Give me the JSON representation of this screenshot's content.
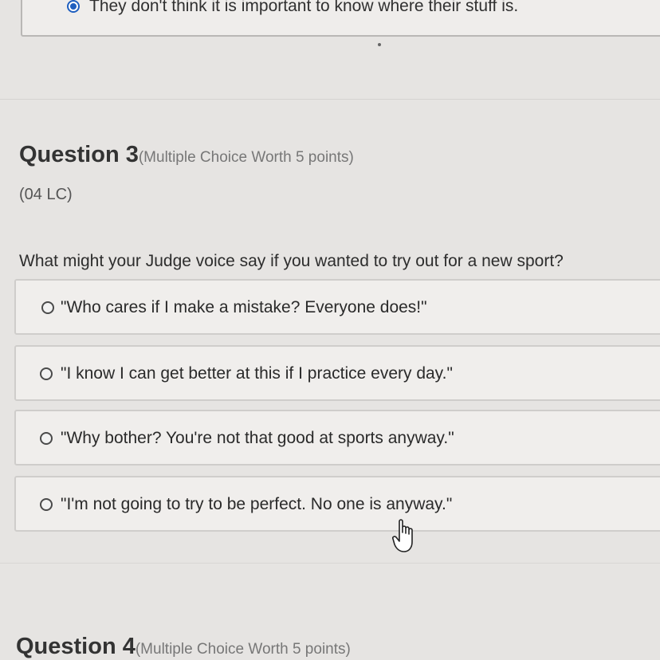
{
  "previous_question": {
    "selected_option": "They don't think it is important to know where their stuff is."
  },
  "question3": {
    "title": "Question 3",
    "meta": "(Multiple Choice Worth 5 points)",
    "code": "(04 LC)",
    "prompt": "What might your Judge voice say if you wanted to try out for a new sport?",
    "options": [
      "\"Who cares if I make a mistake? Everyone does!\"",
      "\"I know I can get better at this if I practice every day.\"",
      "\"Why bother? You're not that good at sports anyway.\"",
      "\"I'm not going to try to be perfect. No one is anyway.\""
    ]
  },
  "question4": {
    "title": "Question 4",
    "meta": "(Multiple Choice Worth 5 points)"
  },
  "icons": {
    "selected_radio": "radio-selected-icon",
    "unselected_radio": "radio-unselected-icon",
    "cursor": "hand-pointer-icon"
  },
  "colors": {
    "accent": "#1f5fbf",
    "background": "#e6e4e2",
    "card": "#f0eeec"
  }
}
